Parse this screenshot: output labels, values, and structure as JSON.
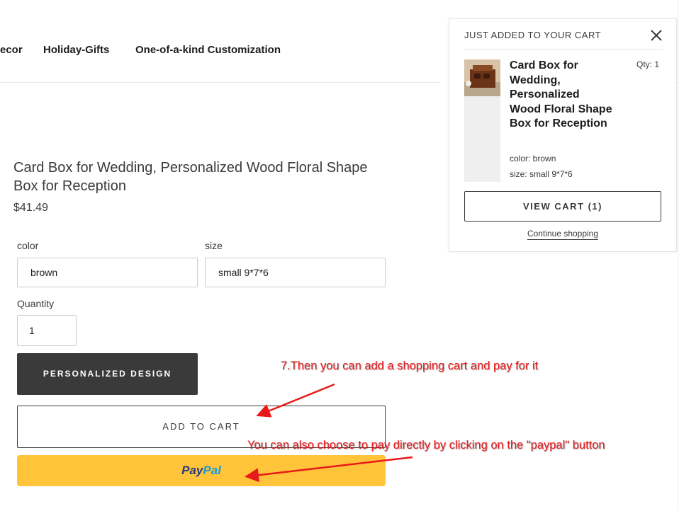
{
  "nav": {
    "items": [
      "ecor",
      "Holiday-Gifts",
      "One-of-a-kind Customization"
    ]
  },
  "product": {
    "title": "Card Box for Wedding, Personalized Wood Floral Shape Box for Reception",
    "price": "$41.49",
    "color_label": "color",
    "color_value": "brown",
    "size_label": "size",
    "size_value": "small 9*7*6",
    "quantity_label": "Quantity",
    "quantity_value": "1",
    "personalized_button": "PERSONALIZED DESIGN",
    "add_to_cart_button": "ADD TO CART",
    "paypal_pay": "Pay",
    "paypal_pal": "Pal"
  },
  "cart_popup": {
    "heading": "JUST ADDED TO YOUR CART",
    "item_name": "Card Box for Wedding, Personalized Wood Floral Shape Box for Reception",
    "qty": "Qty: 1",
    "variant_color": "color:  brown",
    "variant_size": "size:  small 9*7*6",
    "view_cart_button": "VIEW CART (1)",
    "continue_link": "Continue shopping"
  },
  "annotations": {
    "step7": "7.Then you can add a shopping cart and pay for it",
    "paypal_hint": "You can also choose to pay directly by clicking on the \"paypal\" button"
  },
  "colors": {
    "dark_button": "#3a3a3a",
    "paypal_yellow": "#ffc439",
    "annotation_red": "#e8191a"
  }
}
